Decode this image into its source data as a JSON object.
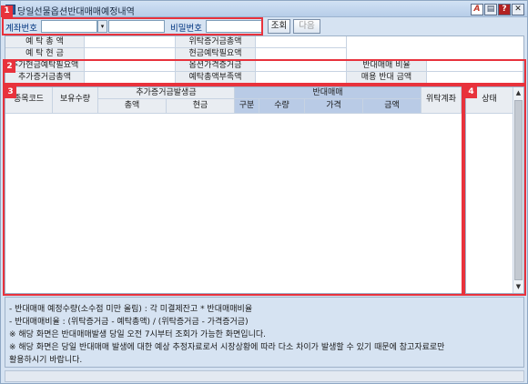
{
  "window": {
    "title": "당일선물옵션반대매매예정내역"
  },
  "title_buttons": {
    "a": "A",
    "print": "▤",
    "help": "?",
    "close": "✕"
  },
  "toolbar": {
    "account_label": "계좌번호",
    "password_label": "비밀번호",
    "query_label": "조회",
    "next_label": "다음",
    "dropdown_glyph": "▾"
  },
  "summary": {
    "r1c1": "예 탁 총 액",
    "r1c2": "위탁증거금총액",
    "r2c1": "예 탁 현 금",
    "r2c2": "현금예탁필요액",
    "r3c1": "추가현금예탁필요액",
    "r3c2": "옵션가격증거금",
    "r3c3": "반대매매 비율",
    "r4c1": "추가증거금총액",
    "r4c2": "예탁총액부족액",
    "r4c3": "매용 반대 금액"
  },
  "grid": {
    "col_code": "종목코드",
    "col_holding": "보유수량",
    "col_margin_group": "추가증거금발생금",
    "col_total": "총액",
    "col_cash": "현금",
    "col_reverse_group": "반대매매",
    "col_type": "구분",
    "col_qty": "수량",
    "col_price": "가격",
    "col_amount": "금액",
    "col_account": "위탁계좌",
    "col_state": "상태"
  },
  "badges": {
    "b1": "1",
    "b2": "2",
    "b3": "3",
    "b4": "4"
  },
  "scroll": {
    "up": "▲",
    "down": "▼"
  },
  "notes": [
    "- 반대매매 예정수량(소수점 미만 올림) : 각 미결제잔고 * 반대매매비율",
    "- 반대매매비율 : (위탁증거금 - 예탁총액) / (위탁증거금 - 가격증거금)",
    "※ 해당 화면은 반대매매발생 당일 오전 7시부터 조회가 가능한 화면입니다.",
    "※ 해당 화면은 당일 반대매매 발생에 대한 예상 추정자료로서 시장상황에 따라 다소 차이가 발생할 수 있기 때문에 참고자료로만",
    "   활용하시기 바랍니다."
  ]
}
